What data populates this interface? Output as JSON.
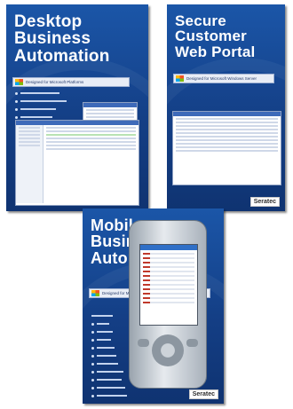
{
  "colors": {
    "box_blue": "#164a97",
    "title_white": "#ffffff"
  },
  "boxes": [
    {
      "title": "Desktop\nBusiness\nAutomation",
      "partner_text": "Designed for Microsoft Platforms",
      "logo": ""
    },
    {
      "title": "Secure\nCustomer\nWeb Portal",
      "partner_text": "Designed for Microsoft Windows Server",
      "logo": "Seratec"
    },
    {
      "title": "Mobile\nBusiness\nAutomation",
      "partner_text": "Designed for Microsoft Windows Mobile",
      "logo": "Seratec"
    }
  ],
  "icons": [
    "windows-logo-icon",
    "pda-device-icon"
  ]
}
